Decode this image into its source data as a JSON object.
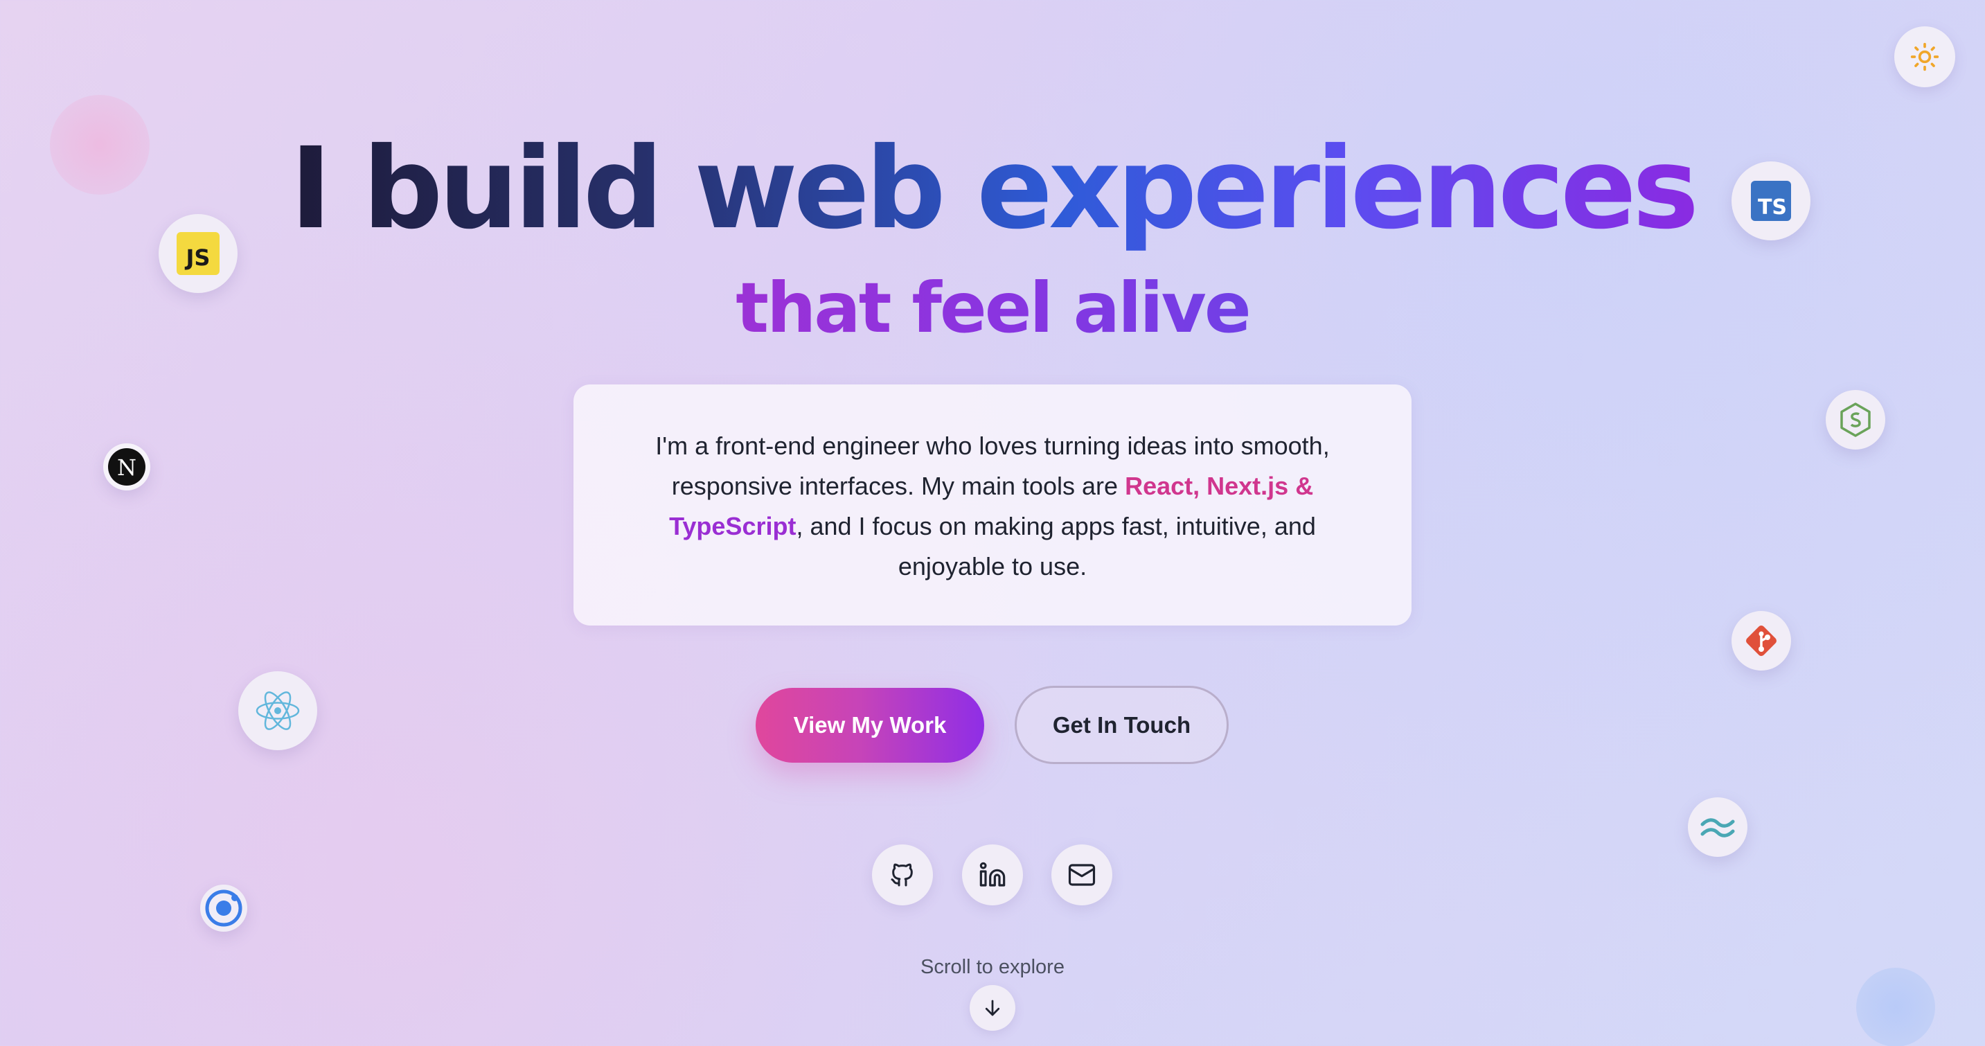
{
  "hero": {
    "title": "I build web experiences",
    "subtitle": "that feel alive",
    "intro": {
      "part1": "I'm a front-end engineer who loves turning ideas into smooth, responsive interfaces. My main tools are ",
      "highlight_pink": "React, Next.js & ",
      "highlight_purple": "TypeScript",
      "part2": ", and I focus on making apps fast, intuitive, and enjoyable to use."
    }
  },
  "buttons": {
    "primary_label": "View My Work",
    "secondary_label": "Get In Touch"
  },
  "social": [
    {
      "name": "github-link",
      "icon": "github-icon"
    },
    {
      "name": "linkedin-link",
      "icon": "linkedin-icon"
    },
    {
      "name": "email-link",
      "icon": "mail-icon"
    }
  ],
  "scroll": {
    "label": "Scroll to explore",
    "icon": "arrow-down-icon"
  },
  "theme_toggle": {
    "icon": "sun-icon"
  },
  "tech_icons": [
    {
      "name": "javascript-icon",
      "label": "JS"
    },
    {
      "name": "typescript-icon",
      "label": "TS"
    },
    {
      "name": "nextjs-icon",
      "label": "N"
    },
    {
      "name": "nodejs-icon"
    },
    {
      "name": "react-icon"
    },
    {
      "name": "git-icon"
    },
    {
      "name": "tailwind-icon"
    },
    {
      "name": "ionic-icon"
    }
  ],
  "colors": {
    "accent_pink": "#d0368e",
    "accent_purple": "#9a2ed3",
    "button_gradient_start": "#e0479c",
    "button_gradient_end": "#8f2ee6",
    "background_start": "#e6d3f1",
    "background_end": "#d3d9f8"
  }
}
